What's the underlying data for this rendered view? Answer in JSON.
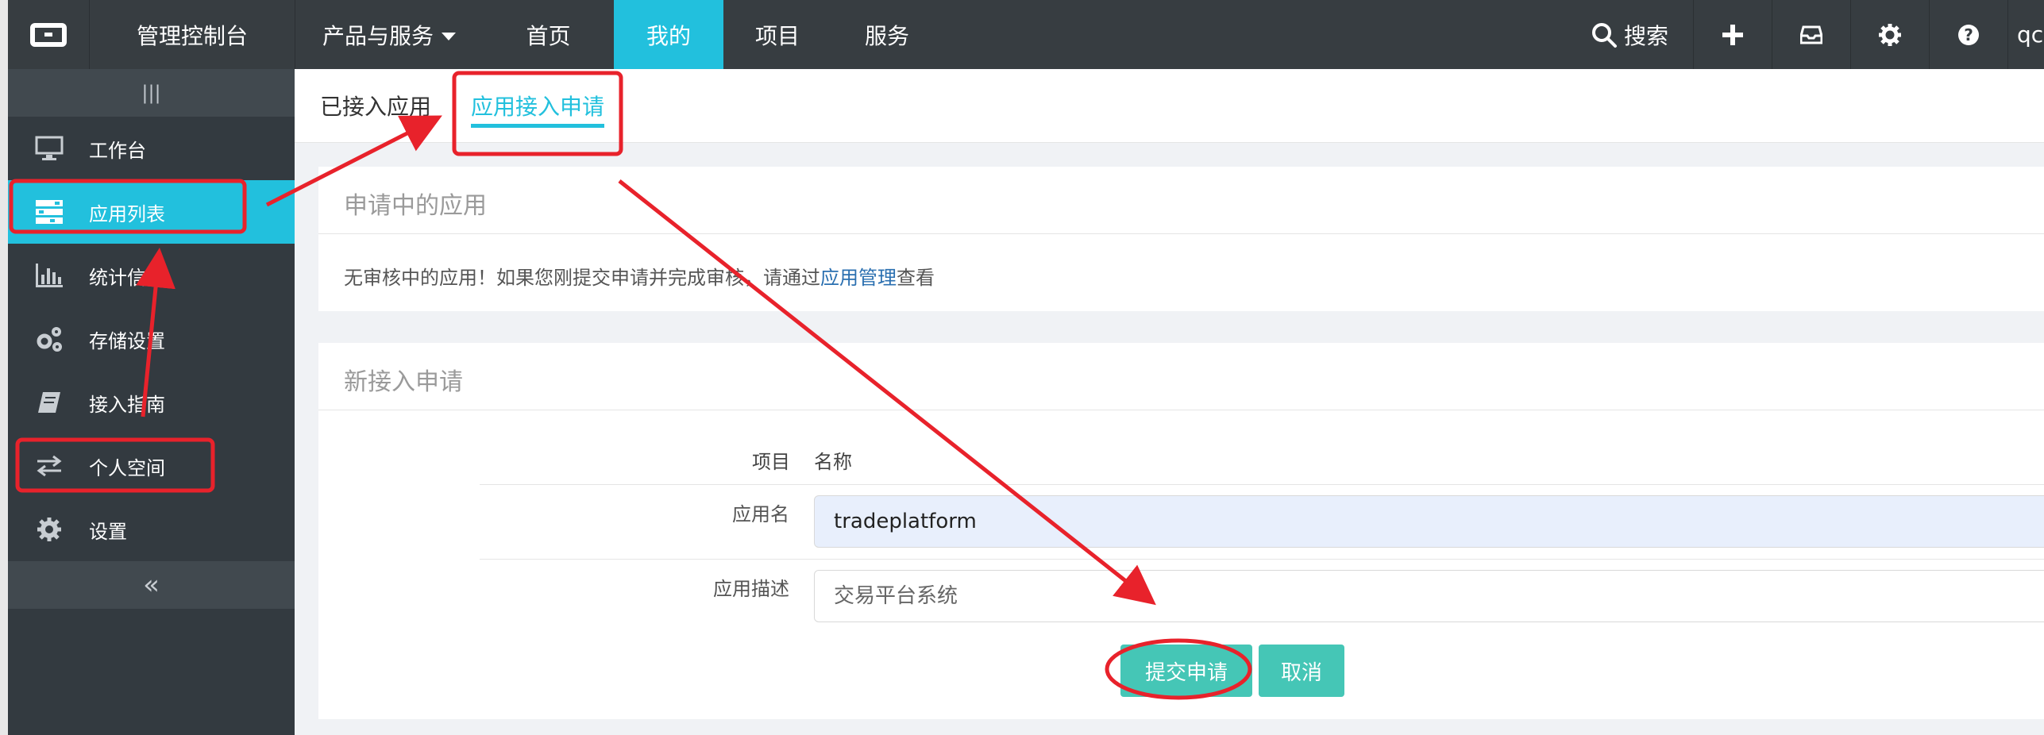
{
  "header": {
    "console_title": "管理控制台",
    "nav": [
      {
        "label": "产品与服务"
      },
      {
        "label": "首页"
      },
      {
        "label": "我的"
      },
      {
        "label": "项目"
      },
      {
        "label": "服务"
      }
    ],
    "search_label": "搜索",
    "user_initials": "qc",
    "accent_color": "#22c0dd",
    "icons": [
      "logo-icon",
      "search-icon",
      "plus-icon",
      "inbox-icon",
      "gear-icon",
      "help-icon"
    ]
  },
  "sidebar": {
    "toggle_glyph": "|||",
    "items": [
      {
        "label": "工作台",
        "icon": "monitor-icon"
      },
      {
        "label": "应用列表",
        "icon": "list-icon"
      },
      {
        "label": "统计信息",
        "icon": "bar-chart-icon"
      },
      {
        "label": "存储设置",
        "icon": "gears-icon"
      },
      {
        "label": "接入指南",
        "icon": "book-icon"
      },
      {
        "label": "个人空间",
        "icon": "exchange-icon"
      },
      {
        "label": "设置",
        "icon": "gear-icon"
      }
    ],
    "collapse_glyph": "«"
  },
  "tabs": [
    {
      "label": "已接入应用"
    },
    {
      "label": "应用接入申请"
    }
  ],
  "pending_panel": {
    "title": "申请中的应用",
    "notice_prefix": "无审核中的应用！如果您刚提交申请并完成审核，请通过",
    "notice_link": "应用管理",
    "notice_suffix": "查看"
  },
  "new_panel": {
    "title": "新接入申请",
    "col_item": "项目",
    "col_name": "名称",
    "app_name_label": "应用名",
    "app_name_value": "tradeplatform",
    "app_desc_label": "应用描述",
    "app_desc_placeholder": "交易平台系统",
    "submit_label": "提交申请",
    "cancel_label": "取消"
  }
}
